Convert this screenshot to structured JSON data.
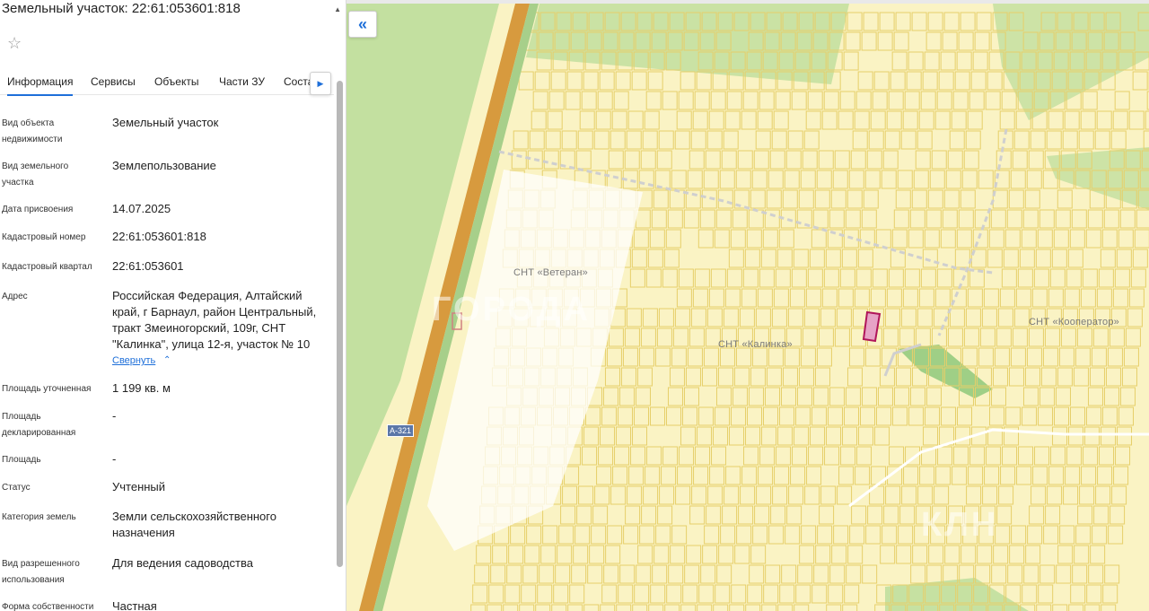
{
  "panel": {
    "title": "Земельный участок: 22:61:053601:818",
    "favorite_icon": "star-outline-icon",
    "scroll_up_icon": "triangle-up-icon",
    "tabs": [
      {
        "label": "Информация",
        "active": true
      },
      {
        "label": "Сервисы",
        "active": false
      },
      {
        "label": "Объекты",
        "active": false
      },
      {
        "label": "Части ЗУ",
        "active": false
      },
      {
        "label": "Соста",
        "active": false
      }
    ],
    "tab_next_icon": "chevron-right-icon",
    "rows": [
      {
        "label": "Вид объекта недвижимости",
        "value": "Земельный участок"
      },
      {
        "label": "Вид земельного участка",
        "value": "Землепользование"
      },
      {
        "label": "Дата присвоения",
        "value": "14.07.2025"
      },
      {
        "label": "Кадастровый номер",
        "value": "22:61:053601:818"
      },
      {
        "label": "Кадастровый квартал",
        "value": "22:61:053601"
      },
      {
        "label": "Адрес",
        "value": "Российская Федерация, Алтайский край, г Барнаул, район Центральный, тракт Змеиногорский, 109г, СНТ \"Калинка\", улица 12-я, участок № 10"
      },
      {
        "label": "Площадь уточненная",
        "value": "1 199 кв. м"
      },
      {
        "label": "Площадь декларированная",
        "value": "-"
      },
      {
        "label": "Площадь",
        "value": "-"
      },
      {
        "label": "Статус",
        "value": "Учтенный"
      },
      {
        "label": "Категория земель",
        "value": "Земли сельскохозяйственного назначения"
      },
      {
        "label": "Вид разрешенного использования",
        "value": "Для ведения садоводства"
      },
      {
        "label": "Форма собственности",
        "value": "Частная"
      }
    ],
    "collapse_label": "Свернуть",
    "collapse_icon": "chevron-up-icon"
  },
  "map": {
    "collapse_button_icon": "double-chevron-left-icon",
    "labels": {
      "veteran": "СНТ «Ветеран»",
      "kalinka": "СНТ «Калинка»",
      "kooperator": "СНТ «Кооператор»"
    },
    "road_badge": "А-321",
    "watermark_1": "ГОРОДА",
    "watermark_2": "КЛН",
    "colors": {
      "background": "#faf3c4",
      "parcel_stroke": "#e6cf6a",
      "green": "#b9dc9a",
      "highway": "#d79a3e",
      "selected_parcel": "#b0155a",
      "accent": "#1e6fd9"
    }
  }
}
